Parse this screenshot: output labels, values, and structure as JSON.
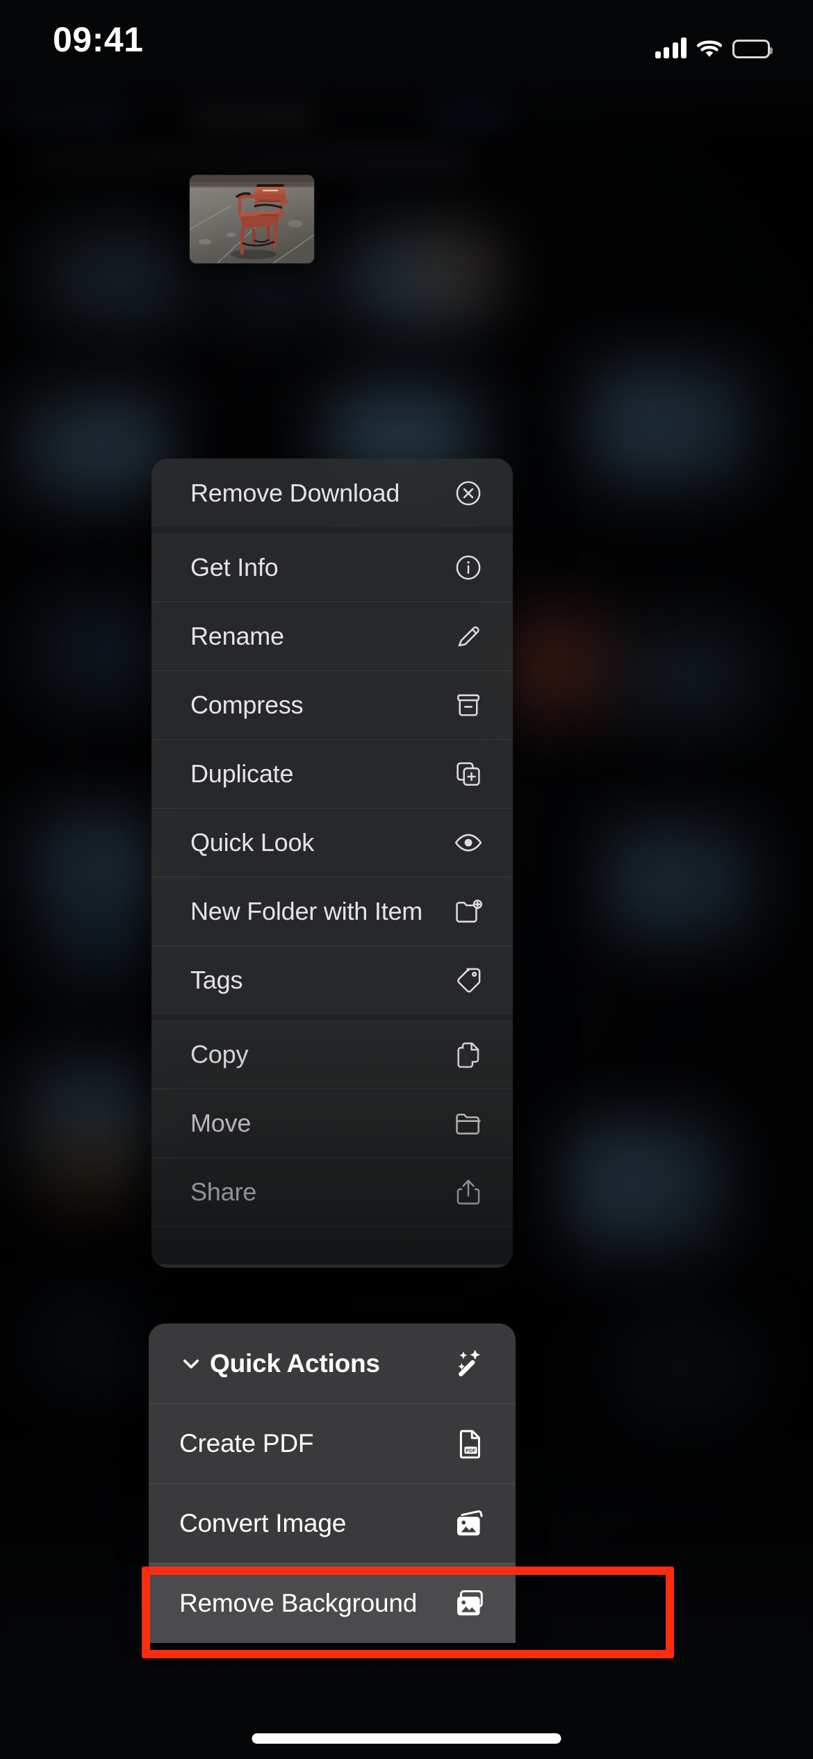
{
  "status_bar": {
    "time": "09:41",
    "cellular_icon": "cellular-signal-icon",
    "wifi_icon": "wifi-icon",
    "battery_icon": "battery-full-icon"
  },
  "preview": {
    "name": "file-preview-thumbnail",
    "description": "Photo of a red wooden armchair on a gray concrete floor"
  },
  "context_menu": {
    "groups": [
      {
        "items": [
          {
            "label": "Remove Download",
            "icon": "x-circle-icon"
          }
        ]
      },
      {
        "items": [
          {
            "label": "Get Info",
            "icon": "info-circle-icon"
          },
          {
            "label": "Rename",
            "icon": "pencil-icon"
          },
          {
            "label": "Compress",
            "icon": "archive-box-icon"
          },
          {
            "label": "Duplicate",
            "icon": "duplicate-plus-icon"
          },
          {
            "label": "Quick Look",
            "icon": "eye-icon"
          },
          {
            "label": "New Folder with Item",
            "icon": "folder-plus-icon"
          },
          {
            "label": "Tags",
            "icon": "tag-icon"
          }
        ]
      },
      {
        "items": [
          {
            "label": "Copy",
            "icon": "doc-on-doc-icon"
          },
          {
            "label": "Move",
            "icon": "folder-icon"
          },
          {
            "label": "Share",
            "icon": "share-up-arrow-icon"
          }
        ]
      }
    ]
  },
  "quick_actions": {
    "header": {
      "label": "Quick Actions",
      "chevron_icon": "chevron-down-icon",
      "icon": "magic-wand-sparkles-icon",
      "expanded": true
    },
    "items": [
      {
        "label": "Create PDF",
        "icon": "pdf-document-icon",
        "highlighted": false
      },
      {
        "label": "Convert Image",
        "icon": "photo-stack-icon",
        "highlighted": false
      },
      {
        "label": "Remove Background",
        "icon": "photo-stack-icon",
        "highlighted": true
      }
    ]
  },
  "annotation": {
    "name": "red-highlight-box",
    "target": "Remove Background",
    "color": "#FA2D0E",
    "border_width_px": 12
  },
  "colors": {
    "screen_background": "#050608",
    "menu_background": "#2C2E30",
    "quick_actions_background": "#3A3A3C",
    "highlight_row_background": "#4B4B4D",
    "menu_label": "#E4E4E6",
    "quick_actions_label": "#FFFFFF",
    "annotation_red": "#FA2D0E",
    "home_indicator": "#FFFFFF"
  },
  "home_indicator": {
    "name": "home-indicator"
  }
}
